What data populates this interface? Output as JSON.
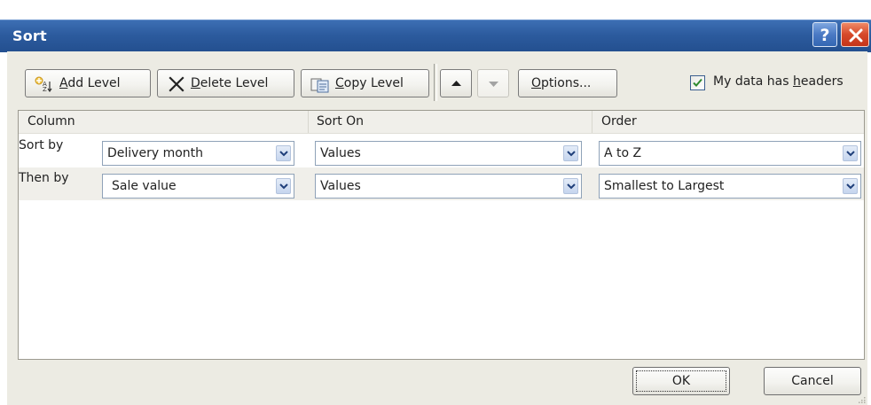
{
  "window": {
    "title": "Sort",
    "help_label": "?"
  },
  "toolbar": {
    "add_level": {
      "prefix": "",
      "accel": "A",
      "rest": "dd Level"
    },
    "delete_level": {
      "prefix": "",
      "accel": "D",
      "rest": "elete Level"
    },
    "copy_level": {
      "prefix": "",
      "accel": "C",
      "rest": "opy Level"
    },
    "options": {
      "prefix": "",
      "accel": "O",
      "rest": "ptions..."
    },
    "headers": {
      "prefix": "My data has ",
      "accel": "h",
      "rest": "eaders",
      "checked": true
    }
  },
  "grid": {
    "headers": {
      "column": "Column",
      "sort_on": "Sort On",
      "order": "Order"
    },
    "rows": [
      {
        "label": "Sort by",
        "column": "Delivery month",
        "sort_on": "Values",
        "order": "A to Z"
      },
      {
        "label": "Then by",
        "column": "Sale value",
        "sort_on": "Values",
        "order": "Smallest to Largest"
      }
    ]
  },
  "footer": {
    "ok": "OK",
    "cancel": "Cancel"
  },
  "colors": {
    "titlebar": "#2c5b9e",
    "dialog_body": "#ecebe3",
    "close_button": "#d6492a",
    "checkbox_check": "#2f8a2f"
  },
  "icons": {
    "add_level": "add-level-icon",
    "delete_level": "x-icon",
    "copy_level": "copy-icon",
    "move_up": "up-triangle-icon",
    "move_down": "down-triangle-icon",
    "dropdown": "chevron-down-icon"
  }
}
